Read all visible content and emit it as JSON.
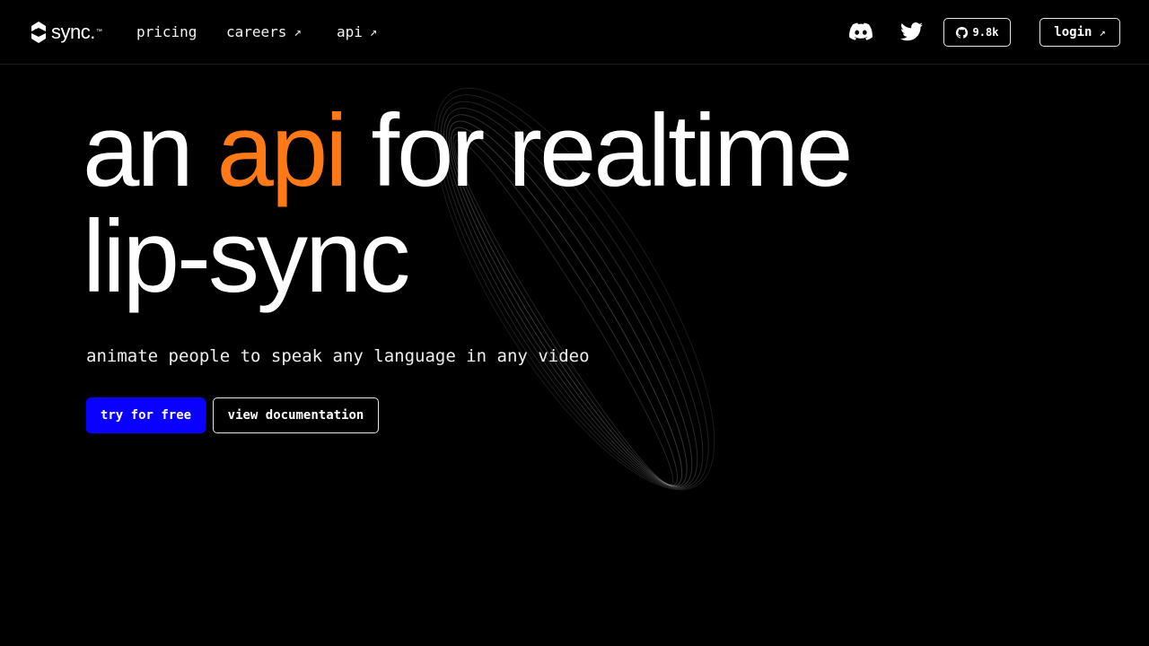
{
  "header": {
    "logo_text": "sync",
    "logo_suffix": ".",
    "logo_tm": "™",
    "nav": [
      {
        "label": "pricing",
        "external": false
      },
      {
        "label": "careers",
        "external": true
      },
      {
        "label": "api",
        "external": true
      }
    ],
    "external_arrow": "↗",
    "github_stars": "9.8k",
    "login_label": "login"
  },
  "hero": {
    "title_word_1": "an",
    "title_accent": "api",
    "title_rest_line_1": "for realtime",
    "title_line_2": "lip-sync",
    "subtitle": "animate people to speak any language in any video",
    "primary_cta": "try for free",
    "secondary_cta": "view documentation"
  },
  "colors": {
    "background": "#000000",
    "accent": "#ff7a16",
    "primary_button": "#0a00ff",
    "text": "#ffffff"
  },
  "icons": [
    "sync-logo-icon",
    "discord-icon",
    "twitter-icon",
    "github-icon",
    "arrow-up-right-icon"
  ]
}
